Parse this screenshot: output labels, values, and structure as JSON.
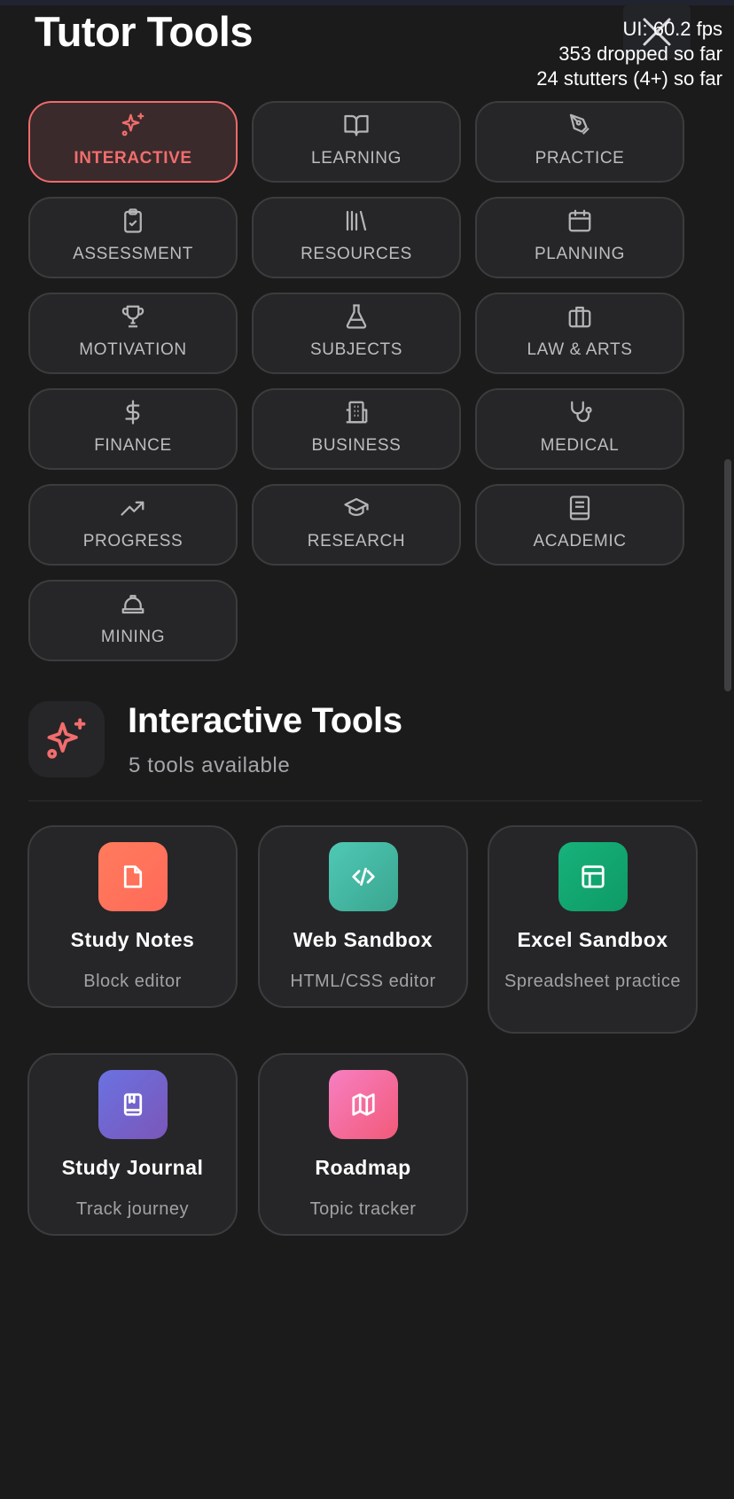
{
  "header": {
    "title": "Tutor Tools"
  },
  "perf_overlay": {
    "fps": "UI: 60.2 fps",
    "dropped": "353 dropped so far",
    "stutters": "24 stutters (4+) so far"
  },
  "categories": [
    {
      "label": "INTERACTIVE",
      "icon": "sparkles-icon",
      "active": true
    },
    {
      "label": "LEARNING",
      "icon": "book-open-icon"
    },
    {
      "label": "PRACTICE",
      "icon": "pen-tool-icon"
    },
    {
      "label": "ASSESSMENT",
      "icon": "clipboard-check-icon"
    },
    {
      "label": "RESOURCES",
      "icon": "library-icon"
    },
    {
      "label": "PLANNING",
      "icon": "calendar-icon"
    },
    {
      "label": "MOTIVATION",
      "icon": "trophy-icon"
    },
    {
      "label": "SUBJECTS",
      "icon": "flask-icon"
    },
    {
      "label": "LAW & ARTS",
      "icon": "briefcase-icon"
    },
    {
      "label": "FINANCE",
      "icon": "dollar-icon"
    },
    {
      "label": "BUSINESS",
      "icon": "building-icon"
    },
    {
      "label": "MEDICAL",
      "icon": "stethoscope-icon"
    },
    {
      "label": "PROGRESS",
      "icon": "trending-up-icon"
    },
    {
      "label": "RESEARCH",
      "icon": "graduation-cap-icon"
    },
    {
      "label": "ACADEMIC",
      "icon": "notebook-icon"
    },
    {
      "label": "MINING",
      "icon": "hard-hat-icon"
    }
  ],
  "section": {
    "title": "Interactive Tools",
    "subtitle": "5 tools available",
    "icon": "sparkles-icon",
    "accent": "#f26d6d"
  },
  "tools": [
    {
      "name": "Study Notes",
      "desc": "Block editor",
      "icon": "file-icon",
      "color_from": "#ff7b5c",
      "color_to": "#ff6a5a"
    },
    {
      "name": "Web Sandbox",
      "desc": "HTML/CSS editor",
      "icon": "code-icon",
      "color_from": "#4fc9b5",
      "color_to": "#3aa58f"
    },
    {
      "name": "Excel Sandbox",
      "desc": "Spreadsheet practice",
      "icon": "table-icon",
      "color_from": "#17b27b",
      "color_to": "#0e9a66"
    },
    {
      "name": "Study Journal",
      "desc": "Track journey",
      "icon": "book-bookmark-icon",
      "color_from": "#6a72e2",
      "color_to": "#7b56b8"
    },
    {
      "name": "Roadmap",
      "desc": "Topic tracker",
      "icon": "map-icon",
      "color_from": "#f77fc2",
      "color_to": "#f25a79"
    }
  ]
}
